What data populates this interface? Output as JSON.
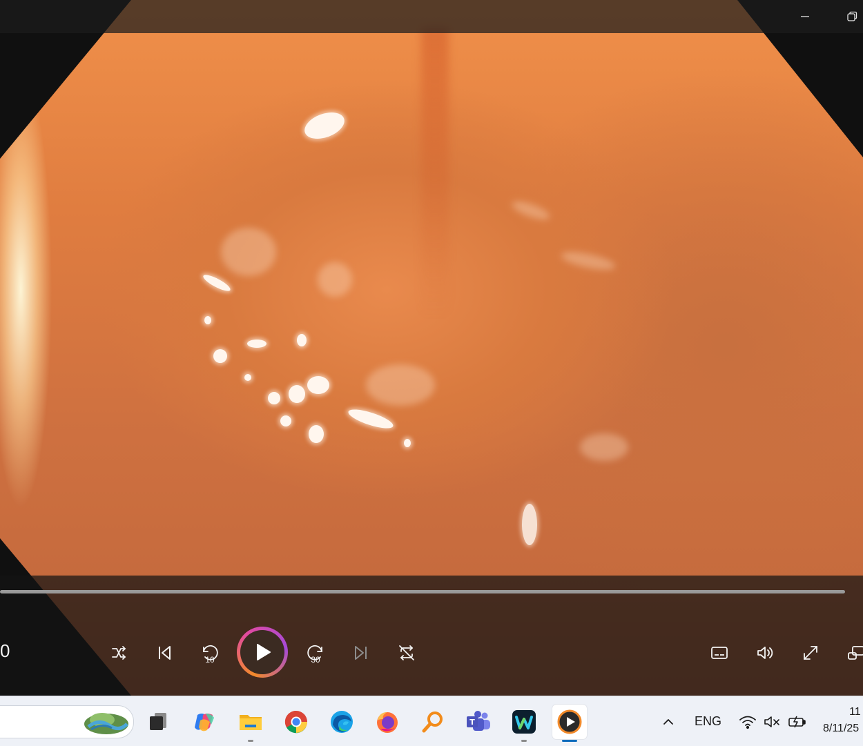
{
  "window": {
    "minimize_icon": "minimize-icon",
    "restore_icon": "restore-icon"
  },
  "player": {
    "time_current": "0",
    "progress_fraction": 0.0,
    "skip_back_label": "10",
    "skip_forward_label": "30",
    "controls": [
      "shuffle-icon",
      "previous-icon",
      "skip-back-10-icon",
      "play-icon",
      "skip-forward-30-icon",
      "next-icon",
      "repeat-icon",
      "subtitles-icon",
      "volume-icon",
      "fullscreen-icon",
      "miniplayer-icon"
    ],
    "accent_colors": [
      "#f28a2a",
      "#e24aa0",
      "#a54ad8"
    ]
  },
  "taskbar": {
    "apps": [
      "task-view-icon",
      "copilot-icon",
      "file-explorer-icon",
      "chrome-icon",
      "edge-icon",
      "firefox-icon",
      "search-magnifier-icon",
      "teams-icon",
      "webex-icon",
      "media-player-icon"
    ],
    "tray": {
      "chevron_icon": "chevron-up-icon",
      "language": "ENG",
      "wifi_icon": "wifi-icon",
      "speaker_icon": "speaker-muted-icon",
      "battery_icon": "battery-charging-icon",
      "time": "11",
      "date": "8/11/25"
    }
  }
}
